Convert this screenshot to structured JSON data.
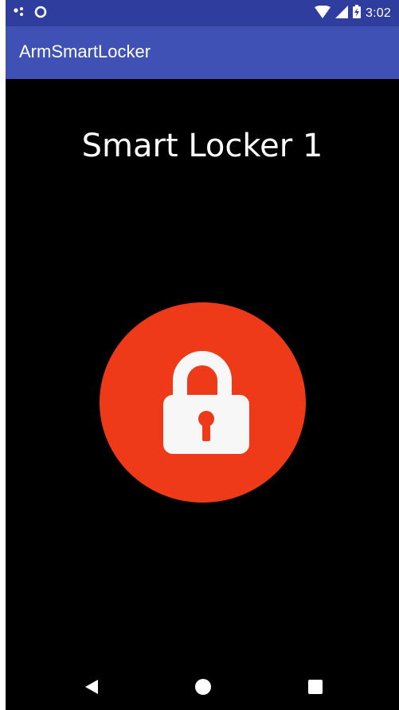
{
  "status_bar": {
    "time": "3:02",
    "icons_left": [
      "notification-dots-icon",
      "sync-circle-icon"
    ],
    "icons_right": [
      "wifi-icon",
      "cell-signal-icon",
      "battery-charging-icon"
    ]
  },
  "app_bar": {
    "title": "ArmSmartLocker",
    "color": "#3f51b5"
  },
  "main": {
    "locker_title": "Smart Locker 1",
    "lock_button": {
      "icon": "padlock-icon",
      "state": "locked",
      "color": "#ee3a18"
    }
  },
  "nav_bar": {
    "buttons": [
      "back-icon",
      "home-icon",
      "recents-icon"
    ]
  }
}
